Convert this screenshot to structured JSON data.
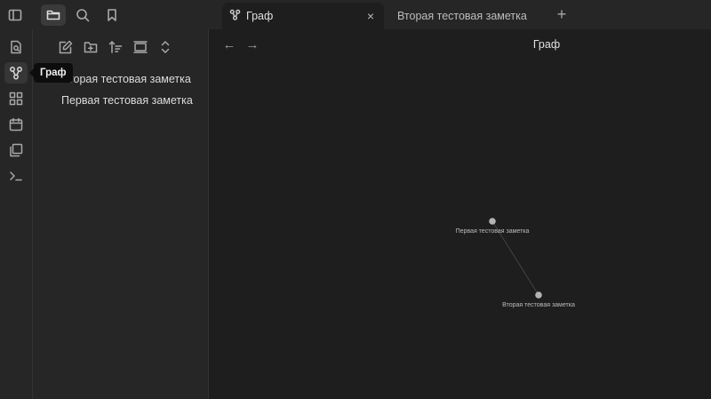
{
  "tabs": [
    {
      "title": "Граф",
      "icon": "graph-icon",
      "active": true,
      "close": "×"
    },
    {
      "title": "Вторая тестовая заметка",
      "active": false
    }
  ],
  "new_tab": "+",
  "tooltip": "Граф",
  "ribbon_icons": [
    "open-quick-switcher-icon",
    "graph-view-icon",
    "canvas-icon",
    "daily-note-icon",
    "templates-icon",
    "command-palette-icon"
  ],
  "sidebar": {
    "toolbar_icons": [
      "new-note-icon",
      "new-folder-icon",
      "sort-icon",
      "collapse-icon",
      "expand-icon"
    ],
    "files": [
      "Вторая тестовая заметка",
      "Первая тестовая заметка"
    ]
  },
  "view": {
    "title": "Граф",
    "back": "←",
    "forward": "→"
  },
  "graph": {
    "nodes": [
      {
        "label": "Первая тестовая заметка"
      },
      {
        "label": "Вторая тестовая заметка"
      }
    ],
    "colors": {
      "node": "#b3b3b3",
      "edge": "#4a4a4a"
    }
  }
}
